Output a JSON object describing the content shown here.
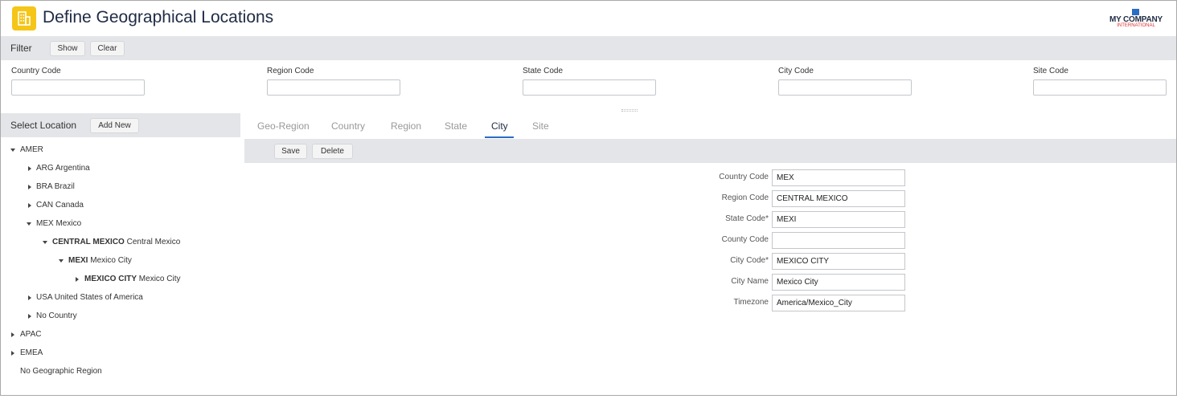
{
  "header": {
    "title": "Define Geographical Locations",
    "logo_name": "MY COMPANY",
    "logo_sub": "INTERNATIONAL"
  },
  "filter": {
    "label": "Filter",
    "show_label": "Show",
    "clear_label": "Clear",
    "fields": [
      {
        "label": "Country Code",
        "value": ""
      },
      {
        "label": "Region Code",
        "value": ""
      },
      {
        "label": "State Code",
        "value": ""
      },
      {
        "label": "City Code",
        "value": ""
      },
      {
        "label": "Site Code",
        "value": ""
      }
    ]
  },
  "select_location": {
    "title": "Select Location",
    "add_new_label": "Add New"
  },
  "tree": [
    {
      "code": "AMER",
      "name": "",
      "expanded": true
    },
    {
      "code": "ARG",
      "name": "Argentina",
      "expanded": false
    },
    {
      "code": "BRA",
      "name": "Brazil",
      "expanded": false
    },
    {
      "code": "CAN",
      "name": "Canada",
      "expanded": false
    },
    {
      "code": "MEX",
      "name": "Mexico",
      "expanded": true
    },
    {
      "code": "CENTRAL MEXICO",
      "name": "Central Mexico",
      "expanded": true
    },
    {
      "code": "MEXI",
      "name": "Mexico City",
      "expanded": true
    },
    {
      "code": "MEXICO CITY",
      "name": "Mexico City",
      "expanded": false
    },
    {
      "code": "USA",
      "name": "United States of America",
      "expanded": false
    },
    {
      "code": "No Country",
      "name": "",
      "expanded": false
    },
    {
      "code": "APAC",
      "name": "",
      "expanded": false
    },
    {
      "code": "EMEA",
      "name": "",
      "expanded": false
    },
    {
      "code": "No Geographic Region",
      "name": "",
      "expanded": null
    }
  ],
  "tabs": [
    "Geo-Region",
    "Country",
    "Region",
    "State",
    "City",
    "Site"
  ],
  "active_tab": "City",
  "actions": {
    "save_label": "Save",
    "delete_label": "Delete"
  },
  "form": [
    {
      "label": "Country Code",
      "value": "MEX"
    },
    {
      "label": "Region Code",
      "value": "CENTRAL MEXICO"
    },
    {
      "label": "State Code*",
      "value": "MEXI"
    },
    {
      "label": "County Code",
      "value": ""
    },
    {
      "label": "City Code*",
      "value": "MEXICO CITY"
    },
    {
      "label": "City Name",
      "value": "Mexico City"
    },
    {
      "label": "Timezone",
      "value": "America/Mexico_City"
    }
  ],
  "colors": {
    "accent": "#2b6cc4",
    "icon_bg": "#f5c518",
    "bar_bg": "#e3e5e8"
  }
}
